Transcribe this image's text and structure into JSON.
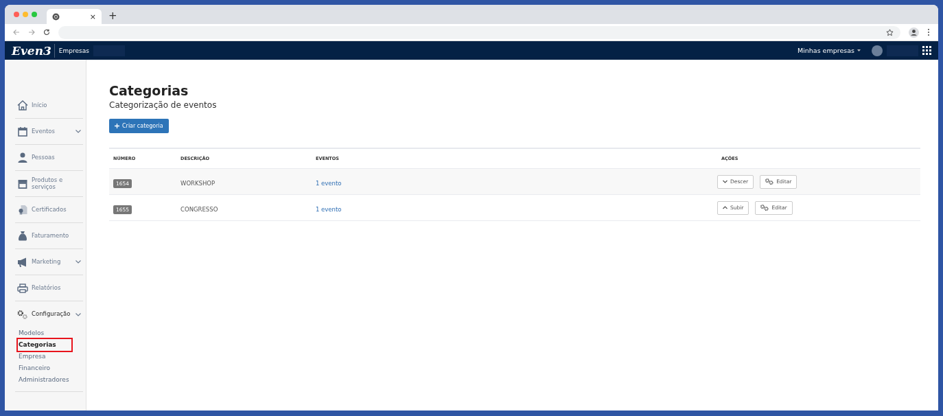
{
  "browser": {
    "tab_close": "×",
    "new_tab": "+"
  },
  "app_bar": {
    "logo": "Even3",
    "section": "Empresas",
    "menu": "Minhas empresas"
  },
  "sidebar": {
    "items": [
      {
        "label": "Início"
      },
      {
        "label": "Eventos",
        "expanded": false
      },
      {
        "label": "Pessoas"
      },
      {
        "label": "Produtos e serviços"
      },
      {
        "label": "Certificados"
      },
      {
        "label": "Faturamento"
      },
      {
        "label": "Marketing",
        "expanded": false
      },
      {
        "label": "Relatórios"
      },
      {
        "label": "Configuração",
        "expanded": true,
        "children": [
          {
            "label": "Modelos",
            "selected": false
          },
          {
            "label": "Categorias",
            "selected": true
          },
          {
            "label": "Empresa",
            "selected": false
          },
          {
            "label": "Financeiro",
            "selected": false
          },
          {
            "label": "Administradores",
            "selected": false
          }
        ]
      }
    ]
  },
  "page": {
    "title": "Categorias",
    "subtitle": "Categorização de eventos",
    "create_button": "Criar categoria"
  },
  "table": {
    "columns": [
      "NÚMERO",
      "DESCRIÇÃO",
      "EVENTOS",
      "AÇÕES"
    ],
    "rows": [
      {
        "number": "1654",
        "description": "WORKSHOP",
        "events": "1 evento",
        "actions": [
          {
            "kind": "down",
            "label": "Descer"
          },
          {
            "kind": "edit",
            "label": "Editar"
          }
        ]
      },
      {
        "number": "1655",
        "description": "CONGRESSO",
        "events": "1 evento",
        "actions": [
          {
            "kind": "up",
            "label": "Subir"
          },
          {
            "kind": "edit",
            "label": "Editar"
          }
        ]
      }
    ]
  }
}
